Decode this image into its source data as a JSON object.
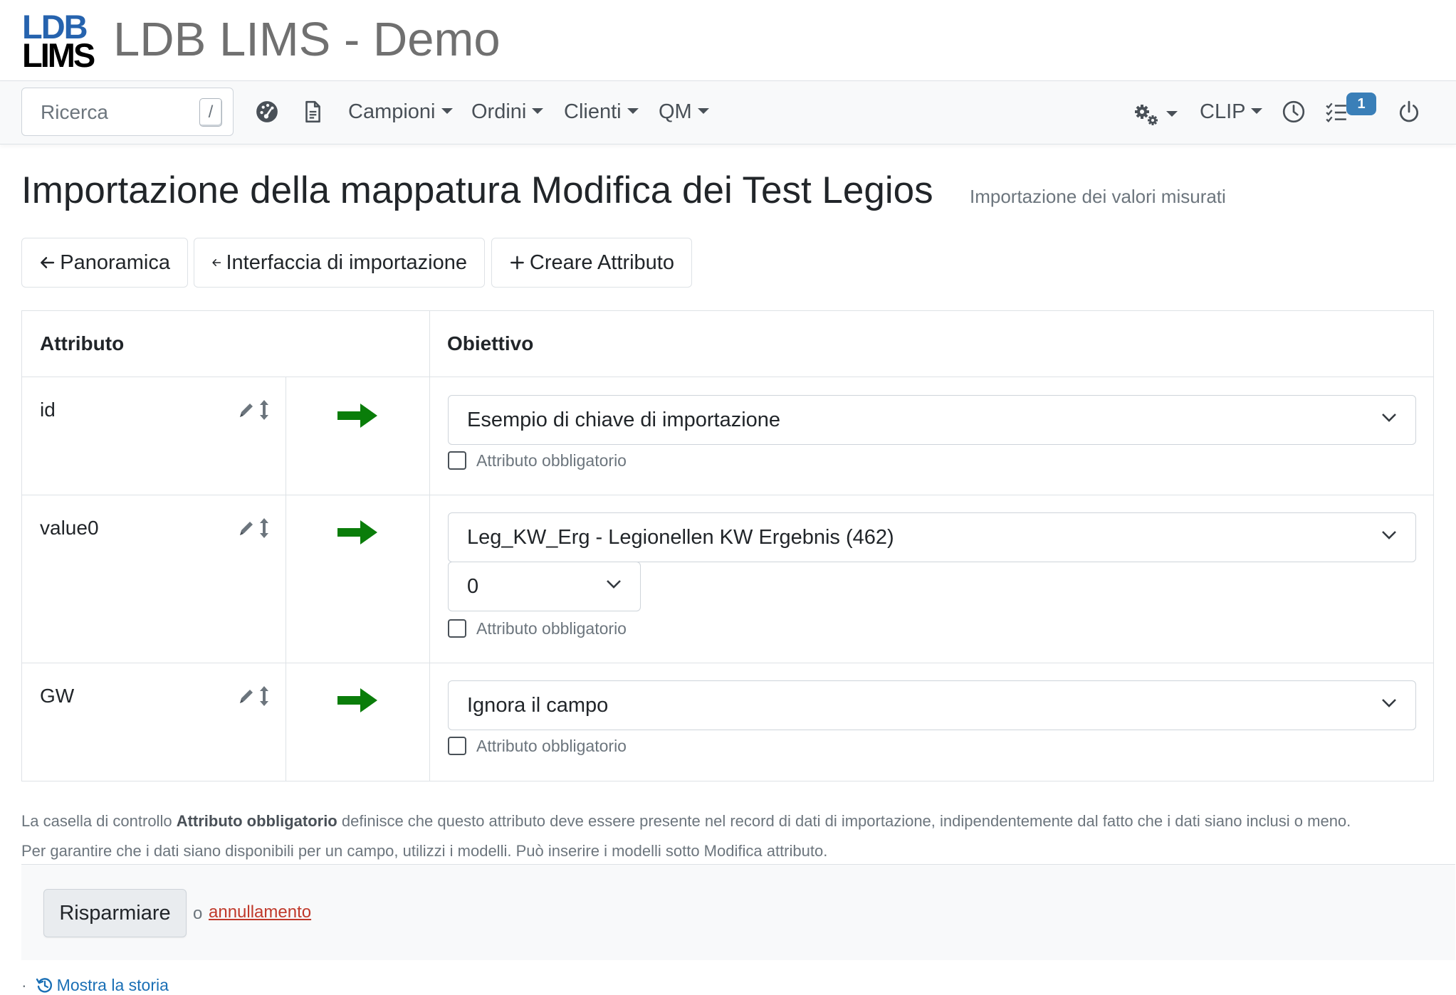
{
  "brand": {
    "logo_top": "LDB",
    "logo_bottom": "LIMS",
    "title": "LDB LIMS - Demo"
  },
  "navbar": {
    "search_placeholder": "Ricerca",
    "search_shortcut": "/",
    "menus": [
      "Campioni",
      "Ordini",
      "Clienti",
      "QM"
    ],
    "right_menu": "CLIP",
    "tasks_badge": "1"
  },
  "page": {
    "title": "Importazione della mappatura Modifica dei Test Legios",
    "subtitle": "Importazione dei valori misurati"
  },
  "actions": {
    "overview": "Panoramica",
    "import_interface": "Interfaccia di importazione",
    "create_attribute": "Creare Attributo"
  },
  "table": {
    "col_attribute": "Attributo",
    "col_target": "Obiettivo",
    "required_label": "Attributo obbligatorio",
    "rows": [
      {
        "name": "id",
        "target": "Esempio di chiave di importazione"
      },
      {
        "name": "value0",
        "target": "Leg_KW_Erg - Legionellen KW Ergebnis (462)",
        "sub_value": "0"
      },
      {
        "name": "GW",
        "target": "Ignora il campo"
      }
    ]
  },
  "help": {
    "line1_pre": "La casella di controllo ",
    "line1_bold": "Attributo obbligatorio",
    "line1_post": " definisce che questo attributo deve essere presente nel record di dati di importazione, indipendentemente dal fatto che i dati siano inclusi o meno.",
    "line2": "Per garantire che i dati siano disponibili per un campo, utilizzi i modelli. Può inserire i modelli sotto Modifica attributo."
  },
  "form": {
    "save": "Risparmiare",
    "or": "o",
    "cancel": "annullamento"
  },
  "history": {
    "dot": "·",
    "label": "Mostra la storia"
  },
  "colors": {
    "brand_blue": "#2663ae",
    "arrow_green": "#0a7d0a",
    "badge": "#3a7fb8",
    "link": "#1a6fb5",
    "cancel": "#c0392b"
  }
}
